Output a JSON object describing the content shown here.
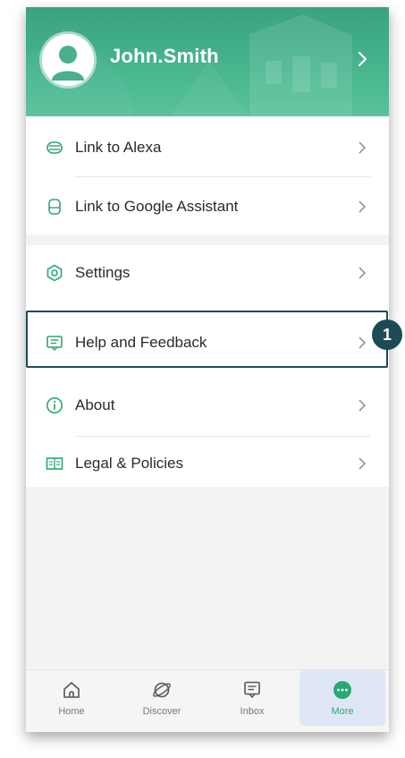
{
  "profile": {
    "username": "John.Smith"
  },
  "menu": {
    "group1": [
      {
        "label": "Link to Alexa",
        "icon": "alexa-icon"
      },
      {
        "label": "Link to Google Assistant",
        "icon": "google-assistant-icon"
      }
    ],
    "group2": [
      {
        "label": "Settings",
        "icon": "settings-icon"
      },
      {
        "label": "Help and Feedback",
        "icon": "feedback-icon"
      },
      {
        "label": "About",
        "icon": "info-icon"
      },
      {
        "label": "Legal & Policies",
        "icon": "book-icon"
      }
    ]
  },
  "callout": {
    "number": "1"
  },
  "tabs": [
    {
      "label": "Home",
      "icon": "home-icon"
    },
    {
      "label": "Discover",
      "icon": "discover-icon"
    },
    {
      "label": "Inbox",
      "icon": "inbox-icon"
    },
    {
      "label": "More",
      "icon": "more-icon",
      "active": true
    }
  ],
  "colors": {
    "accent": "#2aa872",
    "highlight": "#1e4a56",
    "header": "#47b58d"
  }
}
